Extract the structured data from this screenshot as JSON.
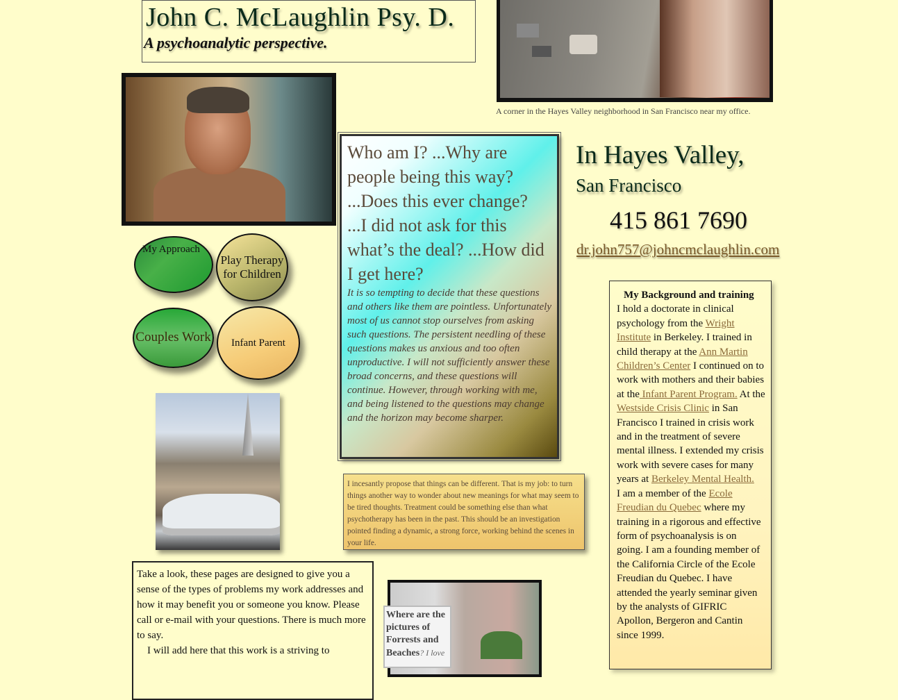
{
  "header": {
    "title": "John C. McLaughlin Psy. D.",
    "tagline": "A psychoanalytic perspective."
  },
  "street_photo": {
    "caption": "A corner in the Hayes Valley neighborhood in San Francisco near my office."
  },
  "nav": {
    "approach": "My Approach",
    "play_therapy": "Play Therapy for Children",
    "couples": "Couples Work",
    "infant_parent": "Infant Parent"
  },
  "questions": {
    "heading": "Who am I? ...Why are people being this way? ...Does this ever change? ...I did not ask for this what’s the deal? ...How did I get here?",
    "body": "It is so tempting to decide that these questions and others like them are pointless. Unfortunately most of us cannot stop ourselves from asking such questions. The persistent needling of these questions makes us anxious and too often unproductive. I will not sufficiently answer these broad concerns, and these questions will continue. However, through working with me, and being listened to the questions may change and the horizon may become sharper."
  },
  "location": {
    "title": "In Hayes Valley,",
    "subtitle": "San Francisco",
    "phone": "415 861 7690",
    "email": "dr.john757@johncmclaughlin.com"
  },
  "background": {
    "heading": "My Background and training",
    "t1": "I hold a doctorate in clinical psychology from the ",
    "l1": "Wright Institute",
    "t2": " in Berkeley. I trained in child therapy at the ",
    "l2": "Ann Martin Children’s Center",
    "t3": " I continued on to work with mothers and their babies at the",
    "l3": " Infant Parent Program.",
    "t4": " At the ",
    "l4": "Westside Crisis Clinic",
    "t5": " in San Francisco I trained in crisis work and in the treatment of severe mental illness. I extended my crisis work with severe cases for many years at ",
    "l5": "Berkeley Mental Health.",
    "t6": "I am a member of the ",
    "l6": "Ecole Freudian du Quebec",
    "t7": " where my training in a rigorous and effective form of psychoanalysis is on going. I am a founding member of the California Circle of the Ecole Freudian du Quebec. I have attended the yearly seminar given by the analysts of GIFRIC Apollon, Bergeron and Cantin since 1999."
  },
  "proposal": {
    "text": "I incesantly propose that things can be different. That is my job: to turn things another way to wonder about new meanings for what may seem to be tired thoughts. Treatment could be something  else than what psychotherapy has been in the past. This should be an investigation pointed finding a dynamic, a strong force, working behind the scenes in your life."
  },
  "take_look": {
    "p1": "Take a look, these pages are designed to give you a sense of the types of problems my work addresses and how it may benefit you or someone you know. Please call or e-mail with your questions. There is much more to say.",
    "p2": "I will add here that this work is a striving to"
  },
  "forrests": {
    "bold": "Where are the pictures of Forrests and Beaches",
    "rest": "? I love"
  }
}
